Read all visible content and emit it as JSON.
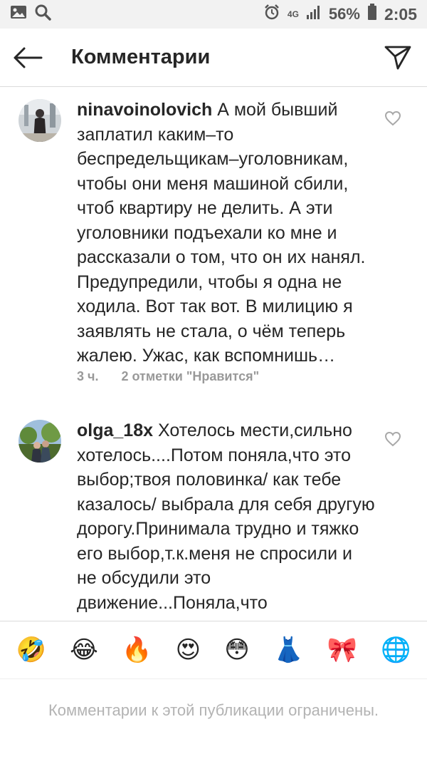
{
  "status_bar": {
    "network": "4G",
    "battery_percent": "56%",
    "time": "2:05",
    "icons": [
      "image-icon",
      "search-icon",
      "alarm-icon",
      "signal-icon",
      "battery-icon"
    ]
  },
  "header": {
    "title": "Комментарии",
    "back_icon": "arrow-left-icon",
    "share_icon": "paper-plane-icon"
  },
  "comments": [
    {
      "username": "ninavoinolovich",
      "text": " А мой бывший заплатил каким–то беспредельщикам–уголовникам, чтобы они меня машиной сбили, чтоб квартиру не делить. А эти уголовники подъехали ко мне и рассказали о том, что он их нанял. Предупредили, чтобы я одна не ходила. Вот так вот. В милицию я заявлять не стала, о чём теперь жалею. Ужас, как вспомнишь…",
      "time": "3 ч.",
      "likes": "2 отметки \"Нравится\""
    },
    {
      "username": "olga_18x",
      "text": " Хотелось мести,сильно хотелось....Потом поняла,что это выбор;твоя половинка/ как тебе казалось/ выбрала для себя другую дорогу.Принимала трудно и тяжко его выбор,т.к.меня не спросили и не обсудили это движение...Поняла,что"
    }
  ],
  "emoji_bar": [
    "🤣",
    "😂",
    "🔥",
    "😍",
    "😳",
    "👗",
    "🎀",
    "🌐"
  ],
  "footer": {
    "restricted_text": "Комментарии к этой публикации ограничены."
  },
  "colors": {
    "text": "#262626",
    "meta": "#999999",
    "divider": "#dbdbdb",
    "status_bar_bg": "#f2f2f2",
    "restricted": "#b3b3b3"
  }
}
